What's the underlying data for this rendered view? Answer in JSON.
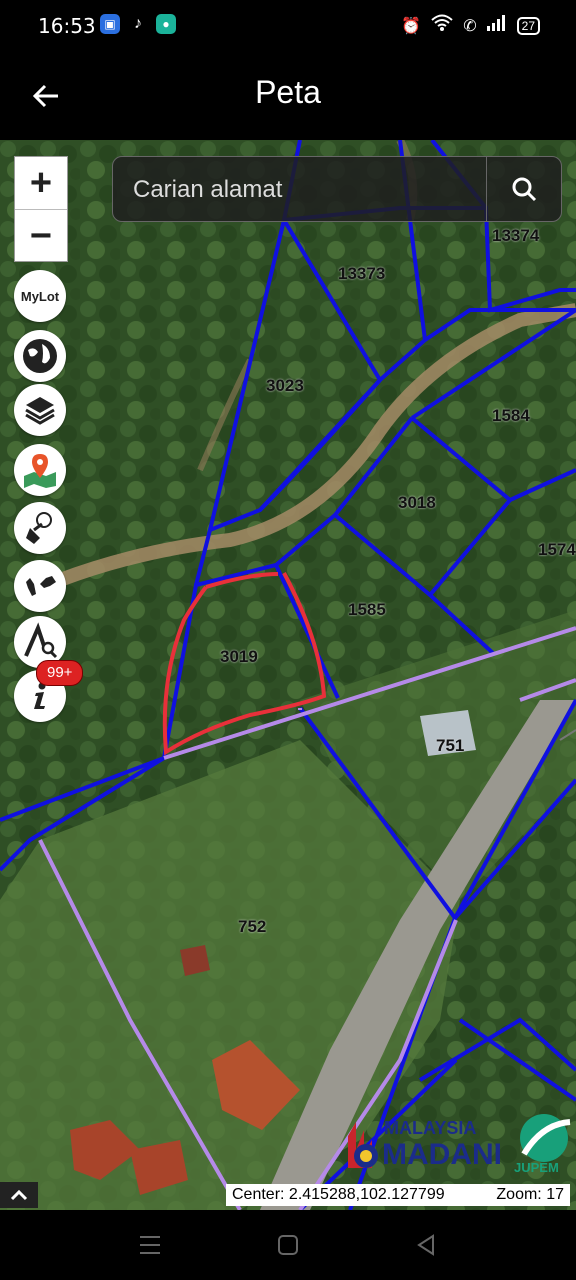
{
  "status": {
    "time": "16:53",
    "battery": "27"
  },
  "appbar": {
    "title": "Peta"
  },
  "search": {
    "placeholder": "Carian alamat"
  },
  "zoom": {
    "in_label": "+",
    "out_label": "−"
  },
  "tools": [
    {
      "name": "mylot-button",
      "label": "MyLot"
    },
    {
      "name": "globe-icon"
    },
    {
      "name": "layers-icon"
    },
    {
      "name": "map-pin-icon"
    },
    {
      "name": "eraser-icon"
    },
    {
      "name": "malaysia-map-icon"
    },
    {
      "name": "measure-icon"
    },
    {
      "name": "info-icon"
    }
  ],
  "badge": {
    "count": "99+"
  },
  "plots": [
    "13374",
    "13373",
    "3023",
    "1584",
    "3018",
    "1574",
    "1585",
    "3019",
    "751",
    "752"
  ],
  "map_info": {
    "center": "Center: 2.415288,102.127799",
    "zoom": "Zoom: 17"
  },
  "logos": {
    "malaysia": "MALAYSIA",
    "madani": "MADANI",
    "jupem": "JUPEM"
  },
  "colors": {
    "boundary": "#1010e0",
    "highlight": "#e8303a",
    "road_line": "#b58ae8"
  }
}
